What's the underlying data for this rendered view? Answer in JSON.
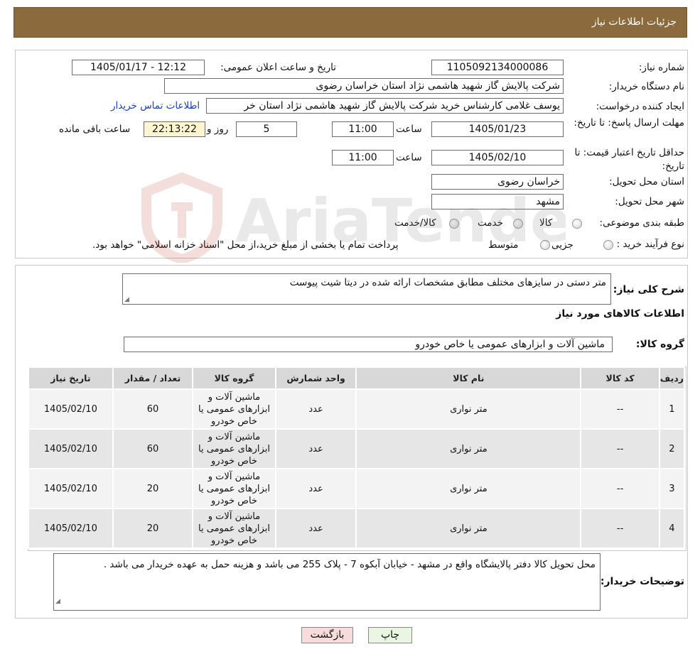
{
  "header": {
    "title": "جزئیات اطلاعات نیاز"
  },
  "form": {
    "need_number_label": "شماره نیاز:",
    "need_number": "1105092134000086",
    "announce_label": "تاریخ و ساعت اعلان عمومی:",
    "announce_value": "1405/01/17 - 12:12",
    "buyer_org_label": "نام دستگاه خریدار:",
    "buyer_org": "شرکت پالایش گاز شهید هاشمی نژاد   استان خراسان رضوی",
    "creator_label": "ایجاد کننده درخواست:",
    "creator": "یوسف غلامی کارشناس خرید شرکت پالایش گاز شهید هاشمی نژاد   استان خر",
    "contact_link": "اطلاعات تماس خریدار",
    "deadline_label": "مهلت ارسال پاسخ: تا تاریخ:",
    "deadline_date": "1405/01/23",
    "time_label": "ساعت",
    "deadline_time": "11:00",
    "days_value": "5",
    "days_label": "روز و",
    "remaining_time": "22:13:22",
    "remaining_label": "ساعت باقی مانده",
    "validity_label": "حداقل تاریخ اعتبار قیمت: تا تاریخ:",
    "validity_date": "1405/02/10",
    "validity_time": "11:00",
    "province_label": "استان محل تحویل:",
    "province": "خراسان رضوی",
    "city_label": "شهر محل تحویل:",
    "city": "مشهد",
    "category_label": "طبقه بندی موضوعی:",
    "category_options": [
      "کالا",
      "خدمت",
      "کالا/خدمت"
    ],
    "process_label": "نوع فرآیند خرید :",
    "process_options": [
      "جزیی",
      "متوسط"
    ],
    "process_note": "پرداخت تمام یا بخشی از مبلغ خرید،از محل \"اسناد خزانه اسلامی\" خواهد بود."
  },
  "details": {
    "description_label": "شرح کلی نیاز:",
    "description": "متر دستی در سایزهای مختلف مطابق مشخصات ارائه شده در دیتا شیت پیوست",
    "goods_info_title": "اطلاعات کالاهای مورد نیاز",
    "goods_group_label": "گروه کالا:",
    "goods_group": "ماشین آلات و ابزارهای عمومی یا خاص خودرو",
    "table": {
      "headers": [
        "ردیف",
        "کد کالا",
        "نام کالا",
        "واحد شمارش",
        "گروه کالا",
        "تعداد / مقدار",
        "تاریخ نیاز"
      ],
      "rows": [
        [
          "1",
          "--",
          "متر نواری",
          "عدد",
          "ماشین آلات و ابزارهای عمومی یا خاص خودرو",
          "60",
          "1405/02/10"
        ],
        [
          "2",
          "--",
          "متر نواری",
          "عدد",
          "ماشین آلات و ابزارهای عمومی یا خاص خودرو",
          "60",
          "1405/02/10"
        ],
        [
          "3",
          "--",
          "متر نواری",
          "عدد",
          "ماشین آلات و ابزارهای عمومی یا خاص خودرو",
          "20",
          "1405/02/10"
        ],
        [
          "4",
          "--",
          "متر نواری",
          "عدد",
          "ماشین آلات و ابزارهای عمومی یا خاص خودرو",
          "20",
          "1405/02/10"
        ]
      ]
    },
    "buyer_notes_label": "توضیحات خریدار:",
    "buyer_notes": "محل تحویل کالا دفتر پالایشگاه واقع در مشهد - خیابان آبکوه 7 - پلاک 255 می باشد و هزینه حمل به عهده خریدار می باشد ."
  },
  "buttons": {
    "print": "چاپ",
    "back": "بازگشت"
  },
  "watermark": "AriaTender.neT"
}
